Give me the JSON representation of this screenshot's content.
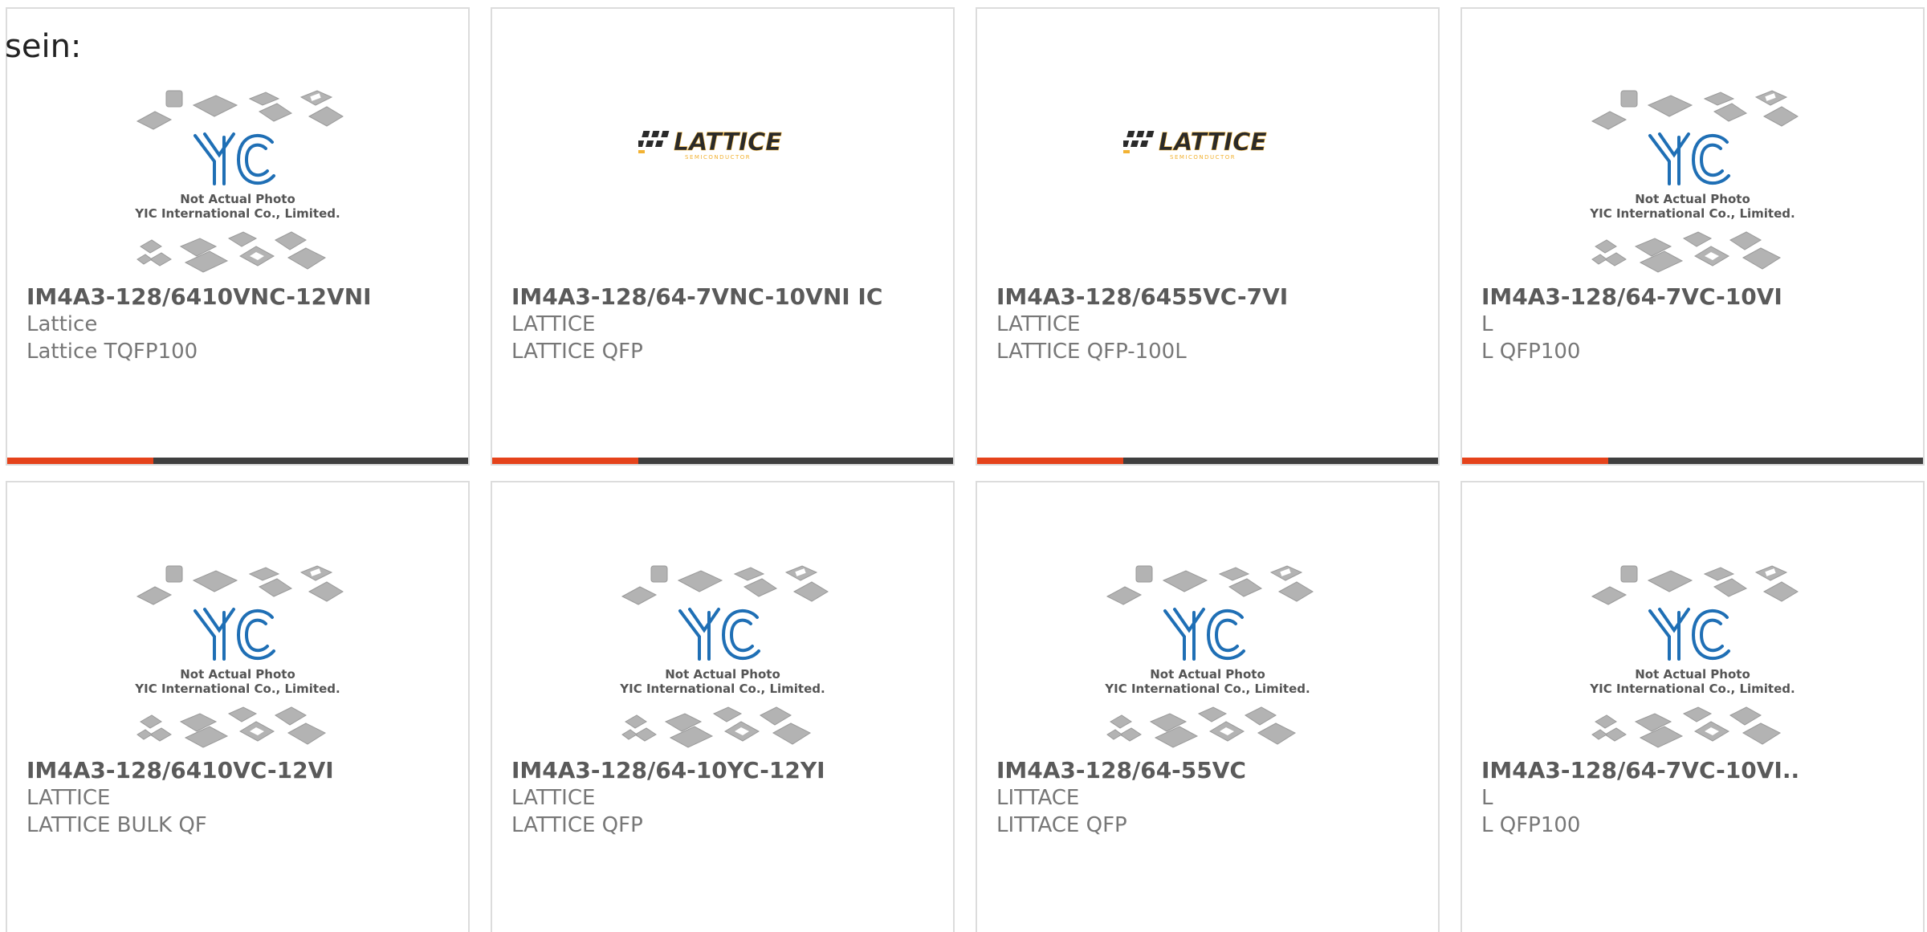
{
  "intro_text": "sein:",
  "colors": {
    "accent": "#e5431b",
    "bar": "#3f3f3f",
    "border": "#dcdcdc",
    "part_text": "#5a5a5a",
    "meta_text": "#777777",
    "yic_blue": "#1f6fb5",
    "lattice_yellow": "#f2b233"
  },
  "placeholder": {
    "line1": "Not Actual Photo",
    "line2": "YIC International Co., Limited.",
    "brand": "YIC"
  },
  "lattice_logo": {
    "word": "LATTICE",
    "sub": "SEMICONDUCTOR"
  },
  "products": [
    {
      "image": "yic-placeholder",
      "part": "IM4A3-128/6410VNC-12VNI",
      "manufacturer": "Lattice",
      "package": "Lattice TQFP100"
    },
    {
      "image": "lattice-logo",
      "part": "IM4A3-128/64-7VNC-10VNI IC",
      "manufacturer": "LATTICE",
      "package": "LATTICE QFP"
    },
    {
      "image": "lattice-logo",
      "part": "IM4A3-128/6455VC-7VI",
      "manufacturer": "LATTICE",
      "package": "LATTICE QFP-100L"
    },
    {
      "image": "yic-placeholder",
      "part": "IM4A3-128/64-7VC-10VI",
      "manufacturer": "L",
      "package": "L QFP100"
    },
    {
      "image": "yic-placeholder",
      "part": "IM4A3-128/6410VC-12VI",
      "manufacturer": "LATTICE",
      "package": "LATTICE BULK QF"
    },
    {
      "image": "yic-placeholder",
      "part": "IM4A3-128/64-10YC-12YI",
      "manufacturer": "LATTICE",
      "package": "LATTICE QFP"
    },
    {
      "image": "yic-placeholder",
      "part": "IM4A3-128/64-55VC",
      "manufacturer": "LITTACE",
      "package": "LITTACE QFP"
    },
    {
      "image": "yic-placeholder",
      "part": "IM4A3-128/64-7VC-10VI..",
      "manufacturer": "L",
      "package": "L QFP100"
    }
  ]
}
